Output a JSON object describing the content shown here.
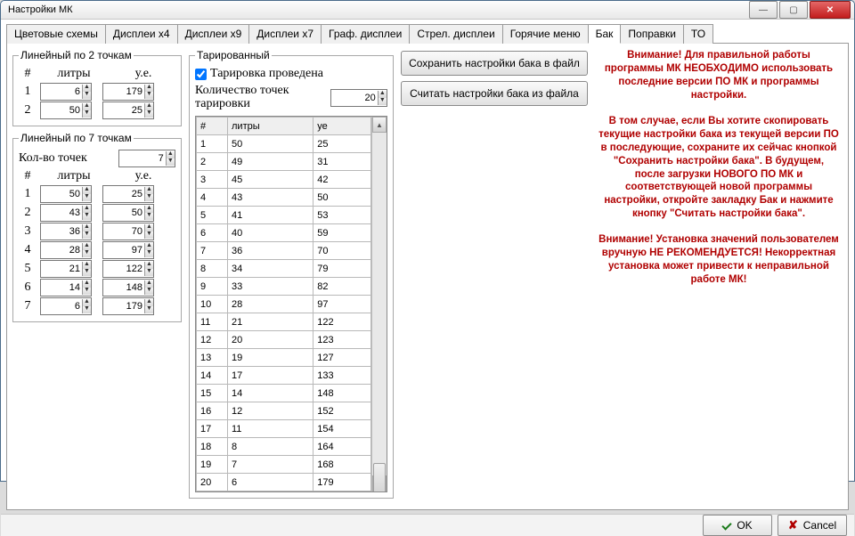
{
  "window": {
    "title": "Настройки МК"
  },
  "tabs": {
    "items": [
      "Цветовые схемы",
      "Дисплеи x4",
      "Дисплеи x9",
      "Дисплеи x7",
      "Граф. дисплеи",
      "Стрел. дисплеи",
      "Горячие меню",
      "Бак",
      "Поправки",
      "ТО"
    ],
    "active_index": 7
  },
  "linear2": {
    "legend": "Линейный по 2 точкам",
    "col_hash": "#",
    "col_liters": "литры",
    "col_ue": "у.е.",
    "rows": [
      {
        "n": "1",
        "liters": "6",
        "ue": "179"
      },
      {
        "n": "2",
        "liters": "50",
        "ue": "25"
      }
    ]
  },
  "linear7": {
    "legend": "Линейный по 7 точкам",
    "points_label": "Кол-во точек",
    "points_value": "7",
    "col_hash": "#",
    "col_liters": "литры",
    "col_ue": "у.е.",
    "rows": [
      {
        "n": "1",
        "liters": "50",
        "ue": "25"
      },
      {
        "n": "2",
        "liters": "43",
        "ue": "50"
      },
      {
        "n": "3",
        "liters": "36",
        "ue": "70"
      },
      {
        "n": "4",
        "liters": "28",
        "ue": "97"
      },
      {
        "n": "5",
        "liters": "21",
        "ue": "122"
      },
      {
        "n": "6",
        "liters": "14",
        "ue": "148"
      },
      {
        "n": "7",
        "liters": "6",
        "ue": "179"
      }
    ]
  },
  "tarred": {
    "legend": "Тарированный",
    "checkbox_label": "Тарировка проведена",
    "checkbox_checked": true,
    "count_label": "Количество точек\nтарировки",
    "count_value": "20",
    "table": {
      "headers": [
        "#",
        "литры",
        "уе"
      ],
      "rows": [
        [
          "1",
          "50",
          "25"
        ],
        [
          "2",
          "49",
          "31"
        ],
        [
          "3",
          "45",
          "42"
        ],
        [
          "4",
          "43",
          "50"
        ],
        [
          "5",
          "41",
          "53"
        ],
        [
          "6",
          "40",
          "59"
        ],
        [
          "7",
          "36",
          "70"
        ],
        [
          "8",
          "34",
          "79"
        ],
        [
          "9",
          "33",
          "82"
        ],
        [
          "10",
          "28",
          "97"
        ],
        [
          "11",
          "21",
          "122"
        ],
        [
          "12",
          "20",
          "123"
        ],
        [
          "13",
          "19",
          "127"
        ],
        [
          "14",
          "17",
          "133"
        ],
        [
          "15",
          "14",
          "148"
        ],
        [
          "16",
          "12",
          "152"
        ],
        [
          "17",
          "11",
          "154"
        ],
        [
          "18",
          "8",
          "164"
        ],
        [
          "19",
          "7",
          "168"
        ],
        [
          "20",
          "6",
          "179"
        ]
      ]
    }
  },
  "buttons": {
    "save": "Сохранить настройки бака в файл",
    "load": "Считать настройки бака из файла",
    "ok": "OK",
    "cancel": "Cancel"
  },
  "warnings": {
    "p1": "Внимание! Для правильной работы программы МК НЕОБХОДИМО использовать последние версии ПО МК и программы настройки.",
    "p2": "В том случае, если Вы хотите скопировать текущие настройки бака из текущей версии ПО в последующие, сохраните их сейчас кнопкой \"Сохранить настройки бака\". В будущем, после загрузки НОВОГО ПО МК и соответствующей новой программы настройки, откройте закладку Бак и нажмите кнопку \"Считать настройки бака\".",
    "p3": "Внимание! Установка значений пользователем вручную НЕ РЕКОМЕНДУЕТСЯ! Некорректная установка может привести к неправильной работе МК!"
  }
}
